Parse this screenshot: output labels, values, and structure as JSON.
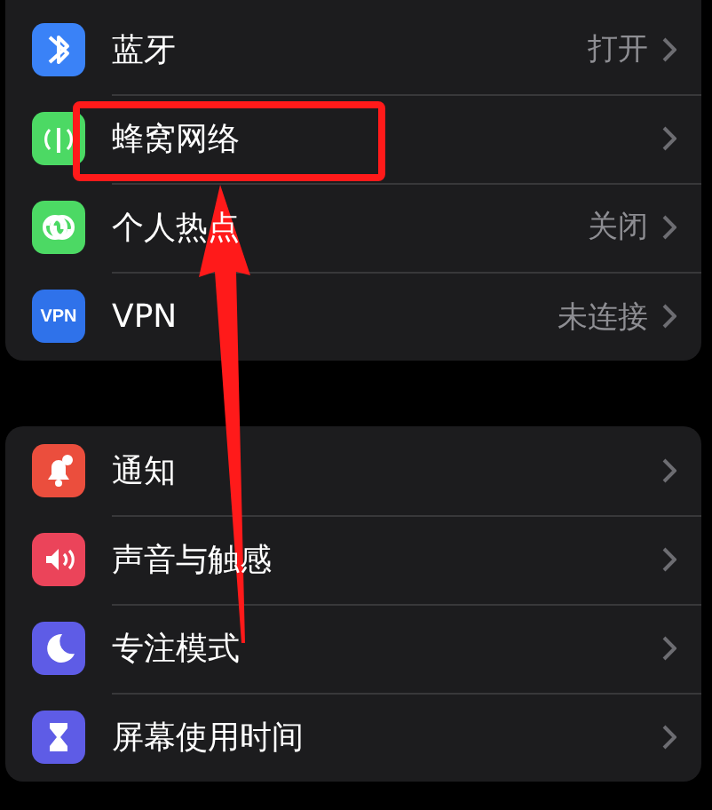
{
  "sections": [
    {
      "items": [
        {
          "label": "蓝牙",
          "value": "打开",
          "highlighted": false
        },
        {
          "label": "蜂窝网络",
          "highlighted": true
        },
        {
          "label": "个人热点",
          "value": "关闭",
          "highlighted": false
        },
        {
          "icon_text": "VPN",
          "label": "VPN",
          "value": "未连接",
          "highlighted": false
        }
      ]
    },
    {
      "items": [
        {
          "label": "通知",
          "highlighted": false
        },
        {
          "label": "声音与触感",
          "highlighted": false
        },
        {
          "label": "专注模式",
          "highlighted": false
        },
        {
          "label": "屏幕使用时间",
          "highlighted": false
        }
      ]
    }
  ],
  "annotation": {
    "arrow": true
  }
}
